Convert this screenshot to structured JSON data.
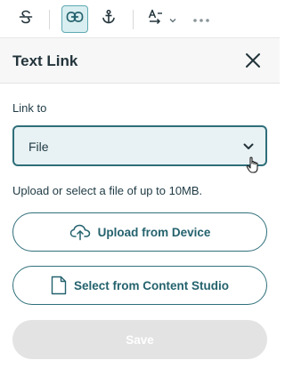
{
  "toolbar": {
    "items": [
      {
        "name": "strikethrough-icon",
        "active": false
      },
      {
        "name": "link-icon",
        "active": true
      },
      {
        "name": "anchor-icon",
        "active": false
      },
      {
        "name": "text-direction-icon",
        "active": false
      },
      {
        "name": "more-icon",
        "active": false
      }
    ]
  },
  "panel": {
    "title": "Text Link",
    "link_to_label": "Link to",
    "link_to_value": "File",
    "helper_text": "Upload or select a file of up to 10MB.",
    "upload_button_label": "Upload from Device",
    "studio_button_label": "Select from Content Studio",
    "save_button_label": "Save",
    "save_disabled": true
  },
  "colors": {
    "accent": "#2f6f7a",
    "accent_text": "#24626d",
    "select_bg": "#e8f1f3",
    "header_bg": "#f7f7f7",
    "disabled_bg": "#e3e3e3"
  }
}
